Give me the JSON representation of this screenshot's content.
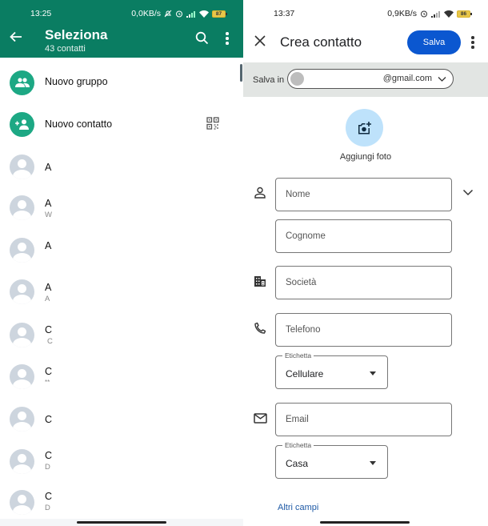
{
  "left": {
    "status_bar": {
      "time": "13:25",
      "speed": "0,0KB/s",
      "battery": "87"
    },
    "header": {
      "title": "Seleziona",
      "subtitle": "43 contatti"
    },
    "actions": [
      {
        "label": "Nuovo gruppo",
        "icon": "group-icon"
      },
      {
        "label": "Nuovo contatto",
        "icon": "add-person-icon"
      }
    ],
    "contacts": [
      {
        "name": "A",
        "sub": ""
      },
      {
        "name": "A",
        "sub": "W"
      },
      {
        "name": "A",
        "sub": ""
      },
      {
        "name": "A",
        "sub": "A"
      },
      {
        "name": "C",
        "sub": "C"
      },
      {
        "name": "C",
        "sub": "**"
      },
      {
        "name": "C",
        "sub": ""
      },
      {
        "name": "C",
        "sub": "D"
      },
      {
        "name": "C",
        "sub": "D"
      }
    ],
    "colors": {
      "header": "#0a7d62",
      "accent": "#1da884"
    }
  },
  "right": {
    "status_bar": {
      "time": "13:37",
      "speed": "0,9KB/s",
      "battery": "86"
    },
    "header": {
      "title": "Crea contatto",
      "save_label": "Salva"
    },
    "save_in": {
      "label": "Salva in",
      "account": "@gmail.com"
    },
    "add_photo_label": "Aggiungi foto",
    "fields": {
      "first_name": "Nome",
      "last_name": "Cognome",
      "company": "Società",
      "phone": "Telefono",
      "phone_label_legend": "Etichetta",
      "phone_label_value": "Cellulare",
      "email": "Email",
      "email_label_legend": "Etichetta",
      "email_label_value": "Casa"
    },
    "more_fields": "Altri campi",
    "colors": {
      "save_button": "#0b57d0",
      "photo_circle": "#bee2fb",
      "link": "#1f5aa6"
    }
  }
}
